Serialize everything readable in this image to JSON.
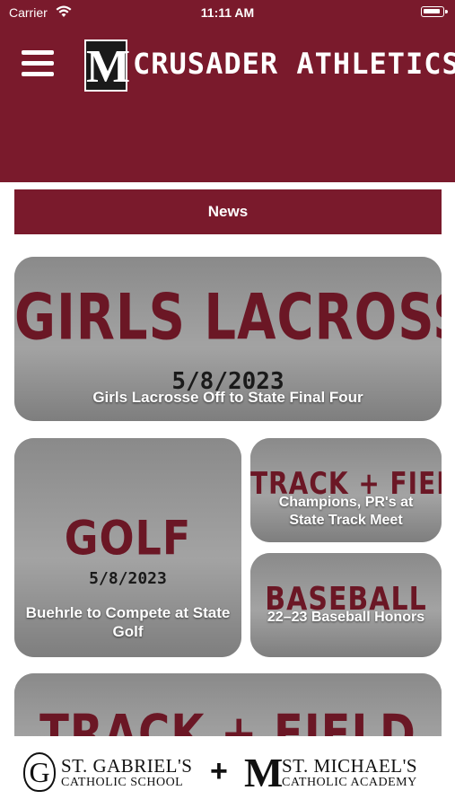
{
  "status_bar": {
    "carrier": "Carrier",
    "time": "11:11 AM"
  },
  "header": {
    "logo_letter": "M",
    "title": "CRUSADER ATHLETICS"
  },
  "news_bar": {
    "label": "News"
  },
  "cards": [
    {
      "sport": "GIRLS LACROSSE",
      "date": "5/8/2023",
      "headline": "Girls Lacrosse Off to State Final Four"
    },
    {
      "sport": "GOLF",
      "date": "5/8/2023",
      "headline": "Buehrle to Compete at State Golf"
    },
    {
      "sport": "TRACK + FIELD",
      "headline": "Champions, PR's at State Track Meet"
    },
    {
      "sport": "BASEBALL",
      "headline": "22–23 Baseball Honors"
    },
    {
      "sport": "TRACK + FIELD"
    }
  ],
  "footer": {
    "left_logo": "G",
    "left_line1": "ST. GABRIEL'S",
    "left_line2": "CATHOLIC SCHOOL",
    "plus": "+",
    "right_logo": "M",
    "right_line1": "ST. MICHAEL'S",
    "right_line2": "CATHOLIC ACADEMY"
  },
  "colors": {
    "brand": "#7a1a2c",
    "card_gray": "#8d8d8d"
  },
  "icons": [
    "wifi-icon",
    "battery-icon",
    "menu-icon"
  ]
}
